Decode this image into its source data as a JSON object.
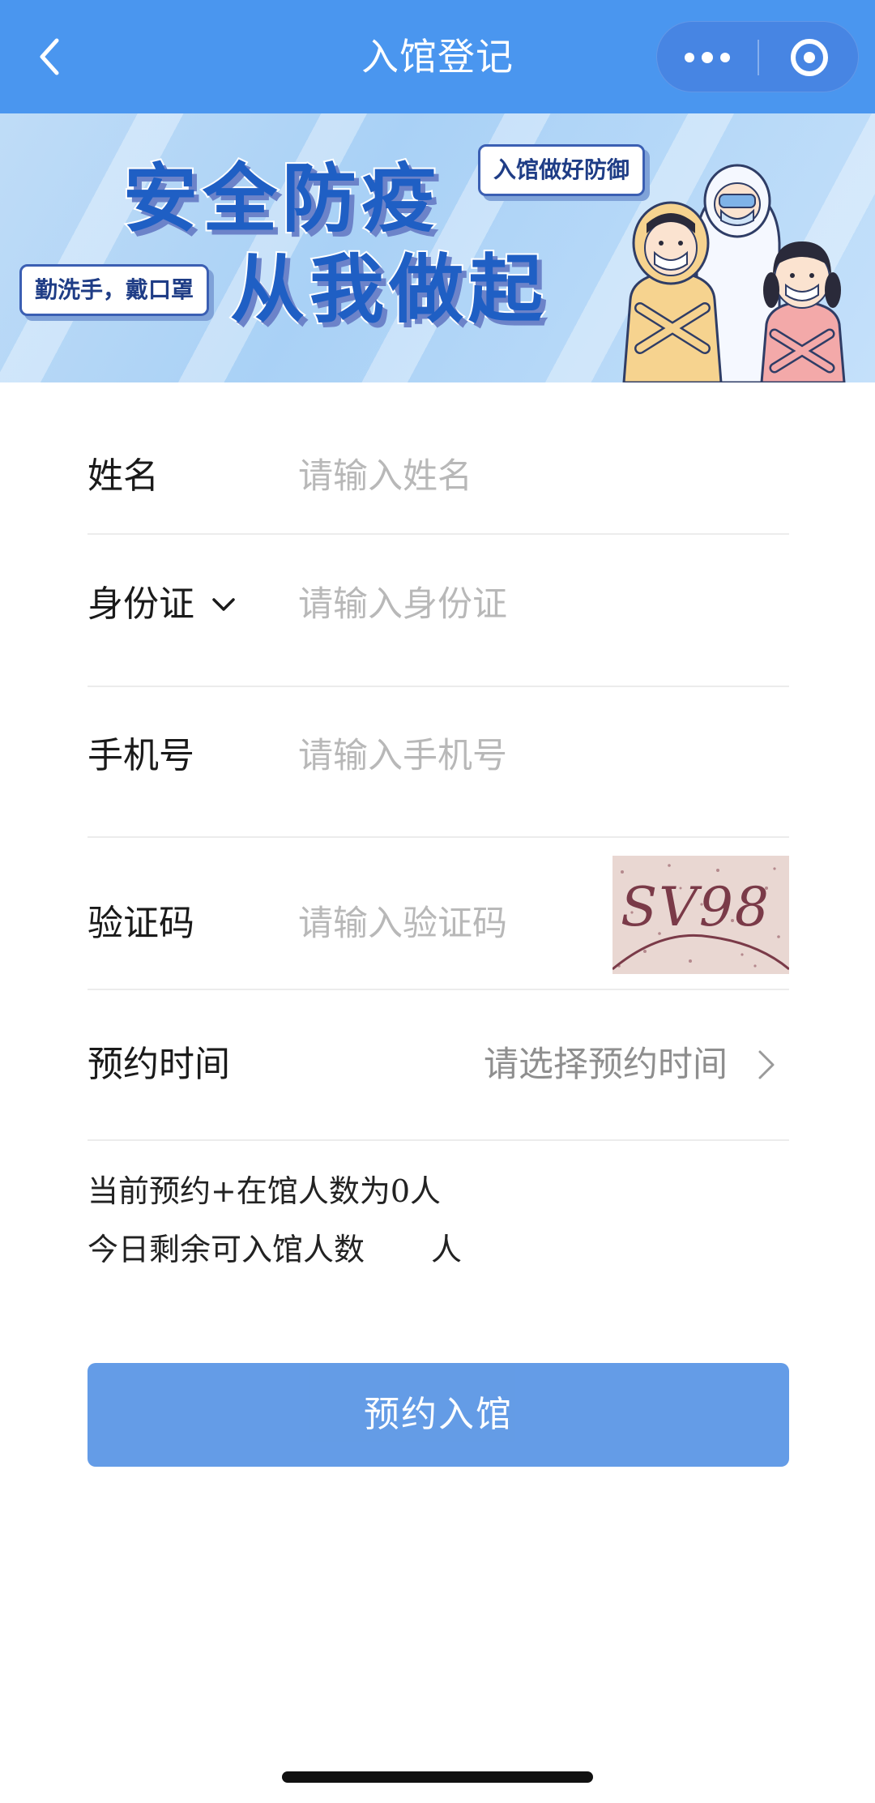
{
  "navbar": {
    "title": "入馆登记",
    "back_icon": "chevron-left-icon",
    "more_icon": "more-dots-icon",
    "close_icon": "target-circle-icon",
    "background": "#4a96ef"
  },
  "banner": {
    "headline_line1": "安全防疫",
    "headline_line2": "从我做起",
    "tag_left": "勤洗手，戴口罩",
    "tag_right": "入馆做好防御",
    "illustration": "masked-people-illustration",
    "headline_color": "#1f5fc4"
  },
  "form": {
    "name": {
      "label": "姓名",
      "placeholder": "请输入姓名"
    },
    "id": {
      "label": "身份证",
      "placeholder": "请输入身份证",
      "dropdown_icon": "chevron-down-icon"
    },
    "phone": {
      "label": "手机号",
      "placeholder": "请输入手机号"
    },
    "captcha": {
      "label": "验证码",
      "placeholder": "请输入验证码",
      "image_text": "SV98"
    },
    "time": {
      "label": "预约时间",
      "value": "请选择预约时间",
      "arrow_icon": "chevron-right-icon"
    }
  },
  "counts": {
    "current_line": "当前预约+在馆人数为0人",
    "remaining_label": "今日剩余可入馆人数",
    "remaining_value": "",
    "remaining_unit": "人"
  },
  "submit": {
    "label": "预约入馆",
    "color": "#5e98e6"
  }
}
